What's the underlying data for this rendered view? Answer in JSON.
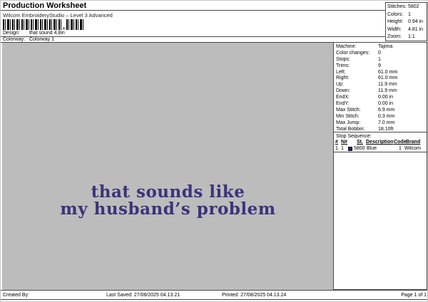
{
  "header": {
    "title": "Production Worksheet",
    "subtitle": "Wilcom EmbroideryStudio – Level 3 Advanced",
    "barcode_separator": ",",
    "design_label": "Design:",
    "design_value": "that sound 4,8in",
    "colorway_label": "Colorway:",
    "colorway_value": "Colorway 1"
  },
  "summary_box": {
    "rows": [
      {
        "label": "Stitches:",
        "value": "5802"
      },
      {
        "label": "Colors:",
        "value": "1"
      },
      {
        "label": "Height:",
        "value": "0.94 in"
      },
      {
        "label": "Width:",
        "value": "4.81 in"
      },
      {
        "label": "Zoom:",
        "value": "1:1"
      }
    ]
  },
  "machine_info": {
    "rows": [
      {
        "label": "Machine:",
        "value": "Tajima"
      },
      {
        "label": "Color changes:",
        "value": "0"
      },
      {
        "label": "Stops:",
        "value": "1"
      },
      {
        "label": "Trims:",
        "value": "9"
      },
      {
        "label": "Left:",
        "value": "61.0 mm"
      },
      {
        "label": "Right:",
        "value": "61.0 mm"
      },
      {
        "label": "Up:",
        "value": "11.9 mm"
      },
      {
        "label": "Down:",
        "value": "11.9 mm"
      },
      {
        "label": "EndX:",
        "value": "0.00 in"
      },
      {
        "label": "EndY:",
        "value": "0.00 in"
      },
      {
        "label": "Max Stitch:",
        "value": "6.9 mm"
      },
      {
        "label": "Min Stitch:",
        "value": "0.3 mm"
      },
      {
        "label": "Max Jump:",
        "value": "7.0 mm"
      },
      {
        "label": "Total Bobbin:",
        "value": "18.10ft"
      }
    ]
  },
  "stop_sequence": {
    "title": "Stop Sequence:",
    "headers": {
      "num": "#",
      "n": "N#",
      "st": "St.",
      "description": "Description",
      "code": "Code",
      "brand": "Brand"
    },
    "rows": [
      {
        "num": "1.",
        "n": "1",
        "st": "5800",
        "description": "Blue",
        "code": "1",
        "brand": "Wilcom",
        "swatch_color": "#221d6e"
      }
    ]
  },
  "preview": {
    "line1": "that sounds like",
    "line2": "my husband’s problem",
    "text_color": "#3b337c",
    "background_color": "#bcbcbc"
  },
  "footer": {
    "created_by": "Created By:",
    "last_saved": "Last Saved: 27/08/2025 04.13.21",
    "printed": "Printed: 27/08/2025 04.13.24",
    "page": "Page 1 of 1"
  }
}
